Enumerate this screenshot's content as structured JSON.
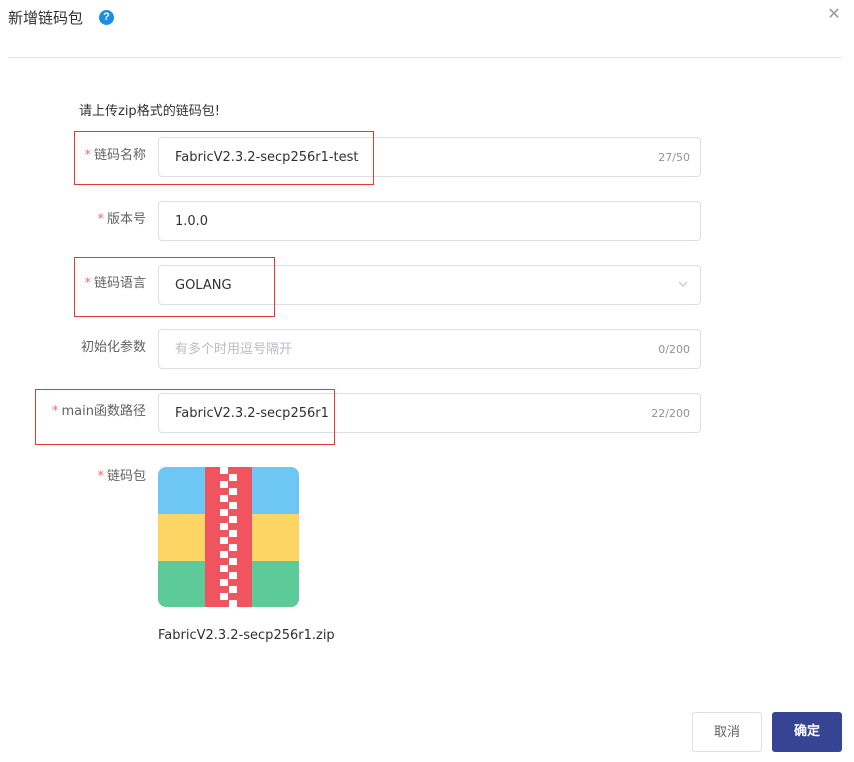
{
  "dialog": {
    "title": "新增链码包",
    "help_icon": "question-circle-icon",
    "close_icon": "close-icon",
    "hint": "请上传zip格式的链码包!"
  },
  "form": {
    "name": {
      "label": "链码名称",
      "required_mark": "*",
      "value": "FabricV2.3.2-secp256r1-test",
      "count": "27/50"
    },
    "version": {
      "label": "版本号",
      "required_mark": "*",
      "value": "1.0.0"
    },
    "language": {
      "label": "链码语言",
      "required_mark": "*",
      "value": "GOLANG",
      "icon": "chevron-down-icon"
    },
    "init_args": {
      "label": "初始化参数",
      "placeholder": "有多个时用逗号隔开",
      "count": "0/200"
    },
    "main_path": {
      "label": "main函数路径",
      "required_mark": "*",
      "value": "FabricV2.3.2-secp256r1",
      "count": "22/200"
    },
    "package": {
      "label": "链码包",
      "required_mark": "*",
      "icon": "zip-file-icon",
      "file_name": "FabricV2.3.2-secp256r1.zip"
    }
  },
  "footer": {
    "cancel_label": "取消",
    "ok_label": "确定"
  },
  "colors": {
    "accent": "#374494",
    "required": "#f56c6c",
    "highlight": "#e53935",
    "zip_blue": "#6ec6f5",
    "zip_yellow": "#fcd564",
    "zip_green": "#5ccb97",
    "zip_red": "#f0545f"
  }
}
